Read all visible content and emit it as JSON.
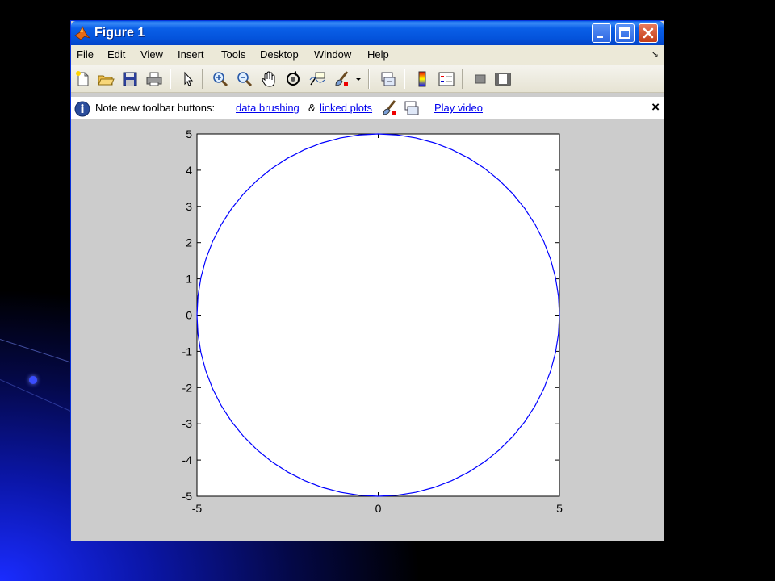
{
  "window": {
    "title": "Figure 1",
    "buttons": [
      "minimize",
      "maximize",
      "close"
    ]
  },
  "menu": {
    "items": [
      "File",
      "Edit",
      "View",
      "Insert",
      "Tools",
      "Desktop",
      "Window",
      "Help"
    ]
  },
  "toolbar": {
    "icons": [
      "new-file-icon",
      "open-folder-icon",
      "save-icon",
      "print-icon",
      "pointer-icon",
      "zoom-in-icon",
      "zoom-out-icon",
      "pan-hand-icon",
      "rotate-3d-icon",
      "data-cursor-icon",
      "brush-icon",
      "dropdown-arrow-icon",
      "linked-plot-icon",
      "colorbar-icon",
      "legend-icon",
      "hide-plot-tools-icon",
      "show-plot-tools-icon"
    ]
  },
  "note": {
    "text": "Note new toolbar buttons:",
    "link_brushing": "data brushing",
    "amp": "&",
    "link_linked": "linked plots",
    "link_video": "Play video",
    "close": "×"
  },
  "chart_data": {
    "type": "line",
    "title": "",
    "xlabel": "",
    "ylabel": "",
    "xlim": [
      -5,
      5
    ],
    "ylim": [
      -5,
      5
    ],
    "xticks": [
      -5,
      0,
      5
    ],
    "yticks": [
      5,
      4,
      3,
      2,
      1,
      0,
      -1,
      -2,
      -3,
      -4,
      -5
    ],
    "grid": false,
    "series": [
      {
        "color": "#0000ff",
        "shape": "circle",
        "center": [
          0,
          0
        ],
        "radius": 5
      }
    ]
  }
}
